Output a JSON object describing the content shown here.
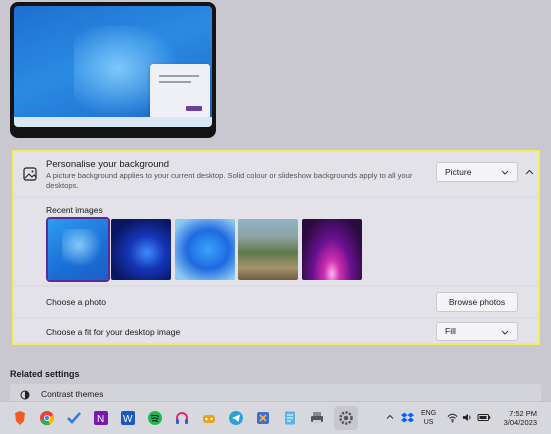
{
  "background": {
    "title": "Personalise your background",
    "subtitle": "A picture background applies to your current desktop. Solid colour or slideshow backgrounds apply to all your desktops.",
    "type_value": "Picture",
    "recent_label": "Recent images",
    "recent_images": [
      {
        "name": "windows-bloom-light"
      },
      {
        "name": "blue-swirl-dark"
      },
      {
        "name": "blue-swirl-light"
      },
      {
        "name": "landscape-boardwalk"
      },
      {
        "name": "purple-glow"
      }
    ],
    "choose_photo_label": "Choose a photo",
    "browse_label": "Browse photos",
    "fit_label": "Choose a fit for your desktop image",
    "fit_value": "Fill"
  },
  "related": {
    "heading": "Related settings",
    "contrast_label": "Contrast themes"
  },
  "taskbar": {
    "apps": [
      "brave",
      "chrome",
      "todo",
      "onenote",
      "word",
      "spotify",
      "headphones",
      "gamebar",
      "telegram",
      "snipping",
      "notepad",
      "printer",
      "settings"
    ],
    "lang_line1": "ENG",
    "lang_line2": "US",
    "time": "7:52 PM",
    "date": "3/04/2023"
  },
  "colors": {
    "highlight": "#f4ec5a",
    "accent": "#5b2a9a"
  }
}
